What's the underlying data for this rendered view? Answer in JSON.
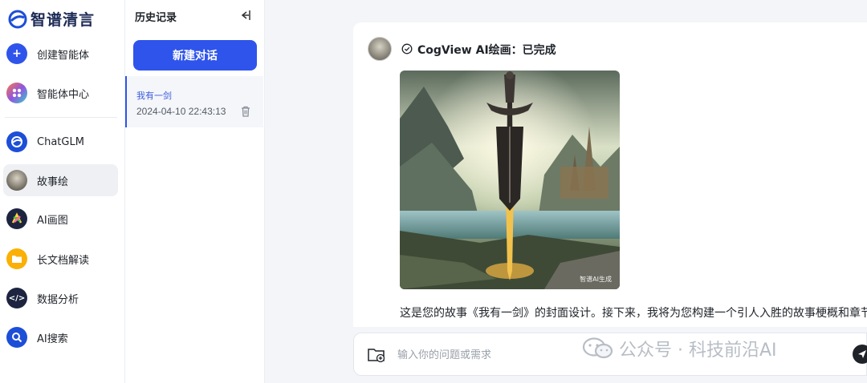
{
  "app": {
    "name": "智谱清言"
  },
  "nav": {
    "items": [
      {
        "label": "创建智能体",
        "icon": "plus-icon"
      },
      {
        "label": "智能体中心",
        "icon": "grid-dots-icon"
      },
      {
        "label": "ChatGLM",
        "icon": "chatglm-logo-icon"
      },
      {
        "label": "故事绘",
        "icon": "story-avatar-icon"
      },
      {
        "label": "AI画图",
        "icon": "ai-draw-icon"
      },
      {
        "label": "长文档解读",
        "icon": "folder-icon"
      },
      {
        "label": "数据分析",
        "icon": "code-icon"
      },
      {
        "label": "AI搜索",
        "icon": "search-icon"
      }
    ],
    "active": "故事绘"
  },
  "history": {
    "title": "历史记录",
    "new_chat_label": "新建对话",
    "items": [
      {
        "name": "我有一剑",
        "date": "2024-04-10 22:43:13"
      }
    ]
  },
  "chat": {
    "status": "CogView AI绘画：已完成",
    "image_watermark": "智谱AI生成",
    "reply": "这是您的故事《我有一剑》的封面设计。接下来，我将为您构建一个引人入胜的故事梗概和章节",
    "input_placeholder": "输入你的问题或需求"
  },
  "overlay": {
    "wechat_watermark": "公众号 · 科技前沿AI"
  },
  "colors": {
    "accent": "#2f54eb",
    "active_bg": "#eef0f4"
  }
}
